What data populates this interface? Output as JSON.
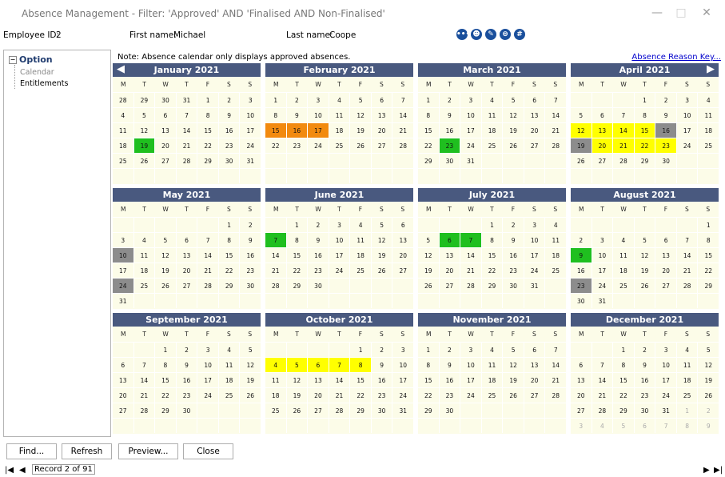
{
  "window": {
    "title": "Absence Management - Filter: 'Approved' AND 'Finalised AND Non-Finalised'",
    "minimize": "—",
    "maximize": "□",
    "close": "✕"
  },
  "employee": {
    "id_label": "Employee ID:",
    "id_value": "2",
    "first_label": "First name:",
    "first_value": "Michael",
    "last_label": "Last name:",
    "last_value": "Coope"
  },
  "toolbar_icons": [
    "more-icon",
    "person-icon",
    "edit-icon",
    "stamp-icon",
    "hash-icon"
  ],
  "sidebar": {
    "option_label": "Option",
    "items": [
      {
        "label": "Calendar"
      },
      {
        "label": "Entitlements"
      }
    ]
  },
  "note": "Note: Absence calendar only displays approved absences.",
  "reason_key_link": "Absence Reason Key...",
  "dow": [
    "M",
    "T",
    "W",
    "T",
    "F",
    "S",
    "S"
  ],
  "colors": {
    "green": "#1fbf1f",
    "orange": "#f28a0f",
    "yellow": "#ffff00",
    "gray": "#8c8c8c",
    "header": "#49597f",
    "cell_bg": "#fcfce8"
  },
  "months": [
    {
      "name": "January 2021",
      "offset": 0,
      "days": 31,
      "prev_tail": [
        28,
        29,
        30,
        31
      ],
      "marks": {
        "19": "green"
      }
    },
    {
      "name": "February 2021",
      "offset": 0,
      "days": 28,
      "prev_tail": [],
      "marks": {
        "15": "orange",
        "16": "orange",
        "17": "orange"
      }
    },
    {
      "name": "March 2021",
      "offset": 0,
      "days": 31,
      "prev_tail": [],
      "marks": {
        "23": "green"
      }
    },
    {
      "name": "April 2021",
      "offset": 3,
      "days": 30,
      "prev_tail": [],
      "marks": {
        "12": "yellow",
        "13": "yellow",
        "14": "yellow",
        "15": "yellow",
        "16": "gray",
        "19": "gray",
        "20": "yellow",
        "21": "yellow",
        "22": "yellow",
        "23": "yellow"
      }
    },
    {
      "name": "May 2021",
      "offset": 5,
      "days": 31,
      "prev_tail": [],
      "marks": {
        "10": "gray",
        "24": "gray"
      }
    },
    {
      "name": "June 2021",
      "offset": 1,
      "days": 30,
      "prev_tail": [],
      "marks": {
        "7": "green"
      }
    },
    {
      "name": "July 2021",
      "offset": 3,
      "days": 31,
      "prev_tail": [],
      "marks": {
        "6": "green",
        "7": "green"
      }
    },
    {
      "name": "August 2021",
      "offset": 6,
      "days": 31,
      "prev_tail": [],
      "marks": {
        "9": "green",
        "23": "gray"
      }
    },
    {
      "name": "September 2021",
      "offset": 2,
      "days": 30,
      "prev_tail": [],
      "marks": {}
    },
    {
      "name": "October 2021",
      "offset": 4,
      "days": 31,
      "prev_tail": [],
      "marks": {
        "4": "yellow",
        "5": "yellow",
        "6": "yellow",
        "7": "yellow",
        "8": "yellow"
      }
    },
    {
      "name": "November 2021",
      "offset": 0,
      "days": 30,
      "prev_tail": [],
      "marks": {}
    },
    {
      "name": "December 2021",
      "offset": 2,
      "days": 31,
      "prev_tail": [],
      "next_head": [
        1,
        2,
        3,
        4,
        5,
        6,
        7,
        8,
        9
      ],
      "marks": {}
    }
  ],
  "buttons": {
    "find": "Find...",
    "refresh": "Refresh",
    "preview": "Preview...",
    "close": "Close"
  },
  "status": {
    "record": "Record 2 of 91"
  }
}
